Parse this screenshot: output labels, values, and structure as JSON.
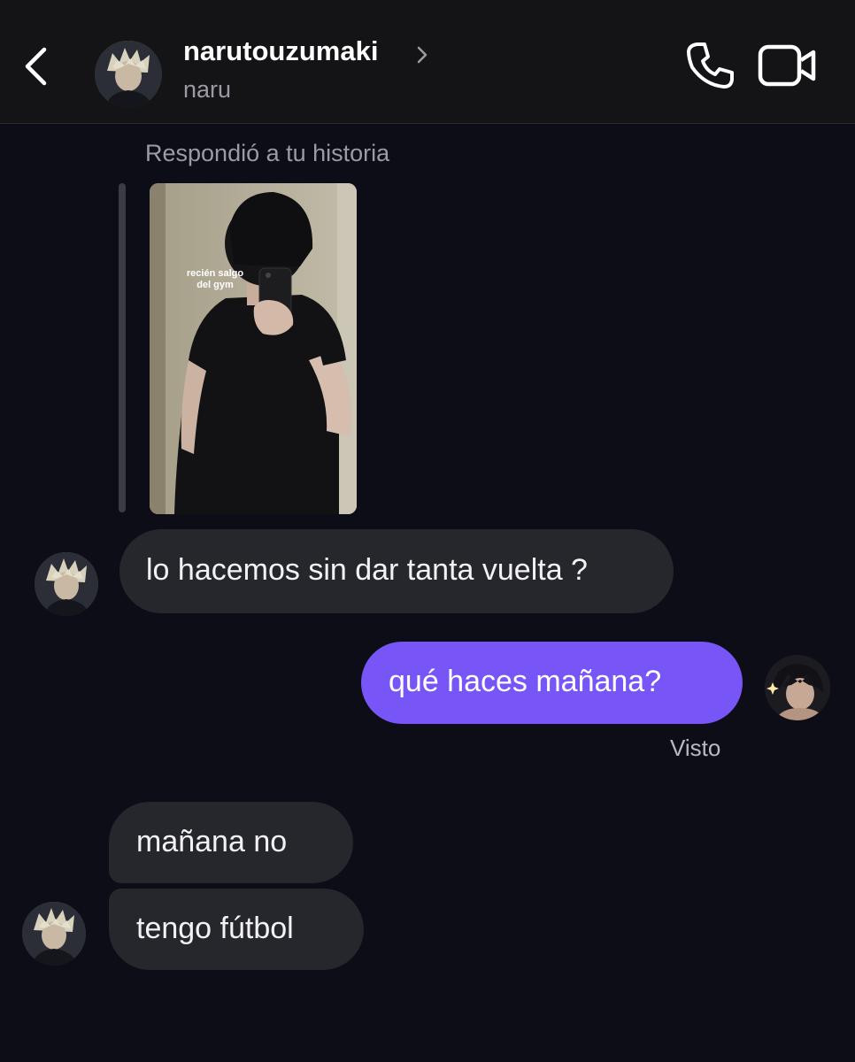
{
  "header": {
    "username": "narutouzumaki",
    "subtitle": "naru",
    "back_icon": "chevron-left-icon",
    "profile_chevron_icon": "chevron-right-icon",
    "call_icon": "phone-icon",
    "video_icon": "video-camera-icon"
  },
  "story_reply": {
    "label": "Respondió a tu historia",
    "story_caption": "recién salgo\ndel gym"
  },
  "messages": [
    {
      "from": "them",
      "text": "lo hacemos sin dar tanta vuelta ?"
    },
    {
      "from": "me",
      "text": "qué haces mañana?"
    },
    {
      "from": "them",
      "text": "mañana no"
    },
    {
      "from": "them",
      "text": "tengo fútbol"
    }
  ],
  "seen_status": "Visto",
  "colors": {
    "background": "#0c0d16",
    "header_background": "#141416",
    "incoming_bubble": "#26272c",
    "outgoing_bubble": "#7755f7",
    "secondary_text": "#9a9ba3"
  }
}
